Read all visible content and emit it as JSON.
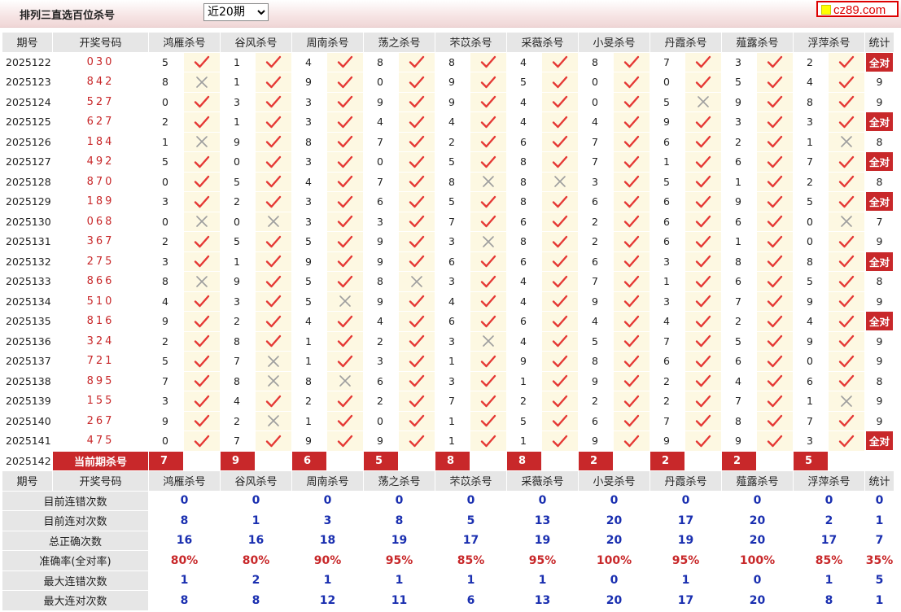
{
  "header": {
    "title": "排列三直选百位杀号",
    "range_selected": "近20期",
    "range_options": [
      "近20期"
    ],
    "logo": "cz89.com"
  },
  "columns": [
    "期号",
    "开奖号码",
    "鸿雁杀号",
    "谷风杀号",
    "周南杀号",
    "荡之杀号",
    "芣苡杀号",
    "采薇杀号",
    "小旻杀号",
    "丹霞杀号",
    "薤露杀号",
    "浮萍杀号",
    "统计"
  ],
  "rows": [
    {
      "period": "2025122",
      "draw": "030",
      "picks": [
        5,
        1,
        4,
        8,
        8,
        4,
        8,
        7,
        3,
        2
      ],
      "hits": [
        1,
        1,
        1,
        1,
        1,
        1,
        1,
        1,
        1,
        1
      ],
      "stat": "全对"
    },
    {
      "period": "2025123",
      "draw": "842",
      "picks": [
        8,
        1,
        9,
        0,
        9,
        5,
        0,
        0,
        5,
        4
      ],
      "hits": [
        0,
        1,
        1,
        1,
        1,
        1,
        1,
        1,
        1,
        1
      ],
      "stat": "9"
    },
    {
      "period": "2025124",
      "draw": "527",
      "picks": [
        0,
        3,
        3,
        9,
        9,
        4,
        0,
        5,
        9,
        8
      ],
      "hits": [
        1,
        1,
        1,
        1,
        1,
        1,
        1,
        0,
        1,
        1
      ],
      "stat": "9"
    },
    {
      "period": "2025125",
      "draw": "627",
      "picks": [
        2,
        1,
        3,
        4,
        4,
        4,
        4,
        9,
        3,
        3
      ],
      "hits": [
        1,
        1,
        1,
        1,
        1,
        1,
        1,
        1,
        1,
        1
      ],
      "stat": "全对"
    },
    {
      "period": "2025126",
      "draw": "184",
      "picks": [
        1,
        9,
        8,
        7,
        2,
        6,
        7,
        6,
        2,
        1
      ],
      "hits": [
        0,
        1,
        1,
        1,
        1,
        1,
        1,
        1,
        1,
        0
      ],
      "stat": "8"
    },
    {
      "period": "2025127",
      "draw": "492",
      "picks": [
        5,
        0,
        3,
        0,
        5,
        8,
        7,
        1,
        6,
        7
      ],
      "hits": [
        1,
        1,
        1,
        1,
        1,
        1,
        1,
        1,
        1,
        1
      ],
      "stat": "全对"
    },
    {
      "period": "2025128",
      "draw": "870",
      "picks": [
        0,
        5,
        4,
        7,
        8,
        8,
        3,
        5,
        1,
        2
      ],
      "hits": [
        1,
        1,
        1,
        1,
        0,
        0,
        1,
        1,
        1,
        1
      ],
      "stat": "8"
    },
    {
      "period": "2025129",
      "draw": "189",
      "picks": [
        3,
        2,
        3,
        6,
        5,
        8,
        6,
        6,
        9,
        5
      ],
      "hits": [
        1,
        1,
        1,
        1,
        1,
        1,
        1,
        1,
        1,
        1
      ],
      "stat": "全对"
    },
    {
      "period": "2025130",
      "draw": "068",
      "picks": [
        0,
        0,
        3,
        3,
        7,
        6,
        2,
        6,
        6,
        0
      ],
      "hits": [
        0,
        0,
        1,
        1,
        1,
        1,
        1,
        1,
        1,
        0
      ],
      "stat": "7"
    },
    {
      "period": "2025131",
      "draw": "367",
      "picks": [
        2,
        5,
        5,
        9,
        3,
        8,
        2,
        6,
        1,
        0
      ],
      "hits": [
        1,
        1,
        1,
        1,
        0,
        1,
        1,
        1,
        1,
        1
      ],
      "stat": "9"
    },
    {
      "period": "2025132",
      "draw": "275",
      "picks": [
        3,
        1,
        9,
        9,
        6,
        6,
        6,
        3,
        8,
        8
      ],
      "hits": [
        1,
        1,
        1,
        1,
        1,
        1,
        1,
        1,
        1,
        1
      ],
      "stat": "全对"
    },
    {
      "period": "2025133",
      "draw": "866",
      "picks": [
        8,
        9,
        5,
        8,
        3,
        4,
        7,
        1,
        6,
        5
      ],
      "hits": [
        0,
        1,
        1,
        0,
        1,
        1,
        1,
        1,
        1,
        1
      ],
      "stat": "8"
    },
    {
      "period": "2025134",
      "draw": "510",
      "picks": [
        4,
        3,
        5,
        9,
        4,
        4,
        9,
        3,
        7,
        9
      ],
      "hits": [
        1,
        1,
        0,
        1,
        1,
        1,
        1,
        1,
        1,
        1
      ],
      "stat": "9"
    },
    {
      "period": "2025135",
      "draw": "816",
      "picks": [
        9,
        2,
        4,
        4,
        6,
        6,
        4,
        4,
        2,
        4
      ],
      "hits": [
        1,
        1,
        1,
        1,
        1,
        1,
        1,
        1,
        1,
        1
      ],
      "stat": "全对"
    },
    {
      "period": "2025136",
      "draw": "324",
      "picks": [
        2,
        8,
        1,
        2,
        3,
        4,
        5,
        7,
        5,
        9
      ],
      "hits": [
        1,
        1,
        1,
        1,
        0,
        1,
        1,
        1,
        1,
        1
      ],
      "stat": "9"
    },
    {
      "period": "2025137",
      "draw": "721",
      "picks": [
        5,
        7,
        1,
        3,
        1,
        9,
        8,
        6,
        6,
        0
      ],
      "hits": [
        1,
        0,
        1,
        1,
        1,
        1,
        1,
        1,
        1,
        1
      ],
      "stat": "9"
    },
    {
      "period": "2025138",
      "draw": "895",
      "picks": [
        7,
        8,
        8,
        6,
        3,
        1,
        9,
        2,
        4,
        6
      ],
      "hits": [
        1,
        0,
        0,
        1,
        1,
        1,
        1,
        1,
        1,
        1
      ],
      "stat": "8"
    },
    {
      "period": "2025139",
      "draw": "155",
      "picks": [
        3,
        4,
        2,
        2,
        7,
        2,
        2,
        2,
        7,
        1
      ],
      "hits": [
        1,
        1,
        1,
        1,
        1,
        1,
        1,
        1,
        1,
        0
      ],
      "stat": "9"
    },
    {
      "period": "2025140",
      "draw": "267",
      "picks": [
        9,
        2,
        1,
        0,
        1,
        5,
        6,
        7,
        8,
        7
      ],
      "hits": [
        1,
        0,
        1,
        1,
        1,
        1,
        1,
        1,
        1,
        1
      ],
      "stat": "9"
    },
    {
      "period": "2025141",
      "draw": "475",
      "picks": [
        0,
        7,
        9,
        9,
        1,
        1,
        9,
        9,
        9,
        3
      ],
      "hits": [
        1,
        1,
        1,
        1,
        1,
        1,
        1,
        1,
        1,
        1
      ],
      "stat": "全对"
    }
  ],
  "current": {
    "period": "2025142",
    "label": "当前期杀号",
    "picks": [
      7,
      9,
      6,
      5,
      8,
      8,
      2,
      2,
      2,
      5
    ]
  },
  "summary": [
    {
      "label": "目前连错次数",
      "values": [
        "0",
        "0",
        "0",
        "0",
        "0",
        "0",
        "0",
        "0",
        "0",
        "0",
        "0"
      ],
      "red": false
    },
    {
      "label": "目前连对次数",
      "values": [
        "8",
        "1",
        "3",
        "8",
        "5",
        "13",
        "20",
        "17",
        "20",
        "2",
        "1"
      ],
      "red": false
    },
    {
      "label": "总正确次数",
      "values": [
        "16",
        "16",
        "18",
        "19",
        "17",
        "19",
        "20",
        "19",
        "20",
        "17",
        "7"
      ],
      "red": false
    },
    {
      "label": "准确率(全对率)",
      "values": [
        "80%",
        "80%",
        "90%",
        "95%",
        "85%",
        "95%",
        "100%",
        "95%",
        "100%",
        "85%",
        "35%"
      ],
      "red": true
    },
    {
      "label": "最大连错次数",
      "values": [
        "1",
        "2",
        "1",
        "1",
        "1",
        "1",
        "0",
        "1",
        "0",
        "1",
        "5"
      ],
      "red": false
    },
    {
      "label": "最大连对次数",
      "values": [
        "8",
        "8",
        "12",
        "11",
        "6",
        "13",
        "20",
        "17",
        "20",
        "8",
        "1"
      ],
      "red": false
    }
  ],
  "colors": {
    "accent": "#c8282a",
    "value_blue": "#1a2fb0",
    "mark_bg": "#fdf8e2",
    "header_bg": "#e6e6e6"
  },
  "icons": {
    "hit": "check-icon",
    "miss": "cross-icon"
  }
}
